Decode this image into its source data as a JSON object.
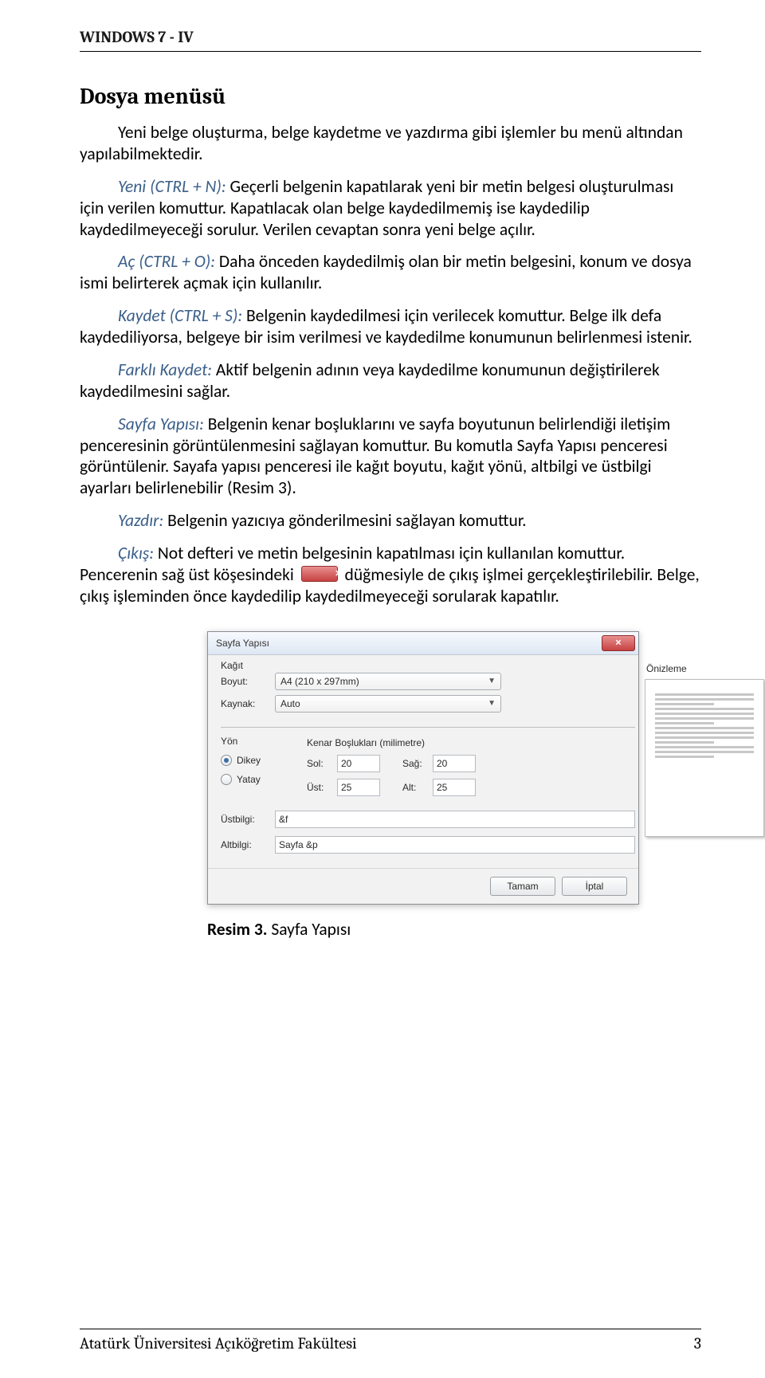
{
  "doc_header": "WINDOWS 7 - IV",
  "heading": "Dosya menüsü",
  "intro": "Yeni belge oluşturma, belge kaydetme ve yazdırma gibi işlemler bu menü altından yapılabilmektedir.",
  "p_yeni_term": "Yeni (CTRL + N):",
  "p_yeni_body": " Geçerli belgenin kapatılarak yeni bir metin belgesi oluşturulması için verilen komuttur. Kapatılacak olan belge kaydedilmemiş ise kaydedilip kaydedilmeyeceği sorulur. Verilen cevaptan sonra yeni belge açılır.",
  "p_ac_term": "Aç (CTRL + O):",
  "p_ac_body": " Daha önceden kaydedilmiş olan bir metin belgesini, konum ve dosya ismi belirterek açmak için kullanılır.",
  "p_kaydet_term": "Kaydet (CTRL + S):",
  "p_kaydet_body": " Belgenin kaydedilmesi için verilecek komuttur. Belge ilk defa kaydediliyorsa, belgeye bir isim verilmesi ve kaydedilme konumunun belirlenmesi istenir.",
  "p_farkli_term": "Farklı Kaydet:",
  "p_farkli_body": " Aktif belgenin adının veya kaydedilme konumunun değiştirilerek kaydedilmesini sağlar.",
  "p_sayfa_term": "Sayfa Yapısı:",
  "p_sayfa_body": " Belgenin kenar boşluklarını ve sayfa boyutunun belirlendiği iletişim penceresinin görüntülenmesini sağlayan komuttur. Bu komutla Sayfa Yapısı penceresi görüntülenir. Sayafa yapısı penceresi ile kağıt boyutu, kağıt yönü, altbilgi ve üstbilgi ayarları belirlenebilir (Resim 3).",
  "p_yazdir_term": "Yazdır:",
  "p_yazdir_body": " Belgenin yazıcıya gönderilmesini sağlayan komuttur.",
  "p_cikis_term": "Çıkış:",
  "p_cikis_body_a": " Not defteri ve metin belgesinin kapatılması için kullanılan komuttur. Pencerenin sağ üst köşesindeki ",
  "p_cikis_body_b": " düğmesiyle de çıkış işlmei gerçekleştirilebilir. Belge, çıkış işleminden önce kaydedilip kaydedilmeyeceği sorularak kapatılır.",
  "dialog": {
    "title": "Sayfa Yapısı",
    "kagit_legend": "Kağıt",
    "boyut_label": "Boyut:",
    "boyut_value": "A4 (210 x 297mm)",
    "kaynak_label": "Kaynak:",
    "kaynak_value": "Auto",
    "preview_label": "Önizleme",
    "yon_legend": "Yön",
    "dikey": "Dikey",
    "yatay": "Yatay",
    "kenar_legend": "Kenar Boşlukları (milimetre)",
    "sol_label": "Sol:",
    "sol_value": "20",
    "sag_label": "Sağ:",
    "sag_value": "20",
    "ust_label": "Üst:",
    "ust_value": "25",
    "alt_label": "Alt:",
    "alt_value": "25",
    "ustbilgi_label": "Üstbilgi:",
    "ustbilgi_value": "&f",
    "altbilgi_label": "Altbilgi:",
    "altbilgi_value": "Sayfa &p",
    "ok": "Tamam",
    "cancel": "İptal"
  },
  "caption_bold": "Resim 3.",
  "caption_rest": " Sayfa Yapısı",
  "footer_left": "Atatürk Üniversitesi Açıköğretim Fakültesi",
  "footer_right": "3"
}
